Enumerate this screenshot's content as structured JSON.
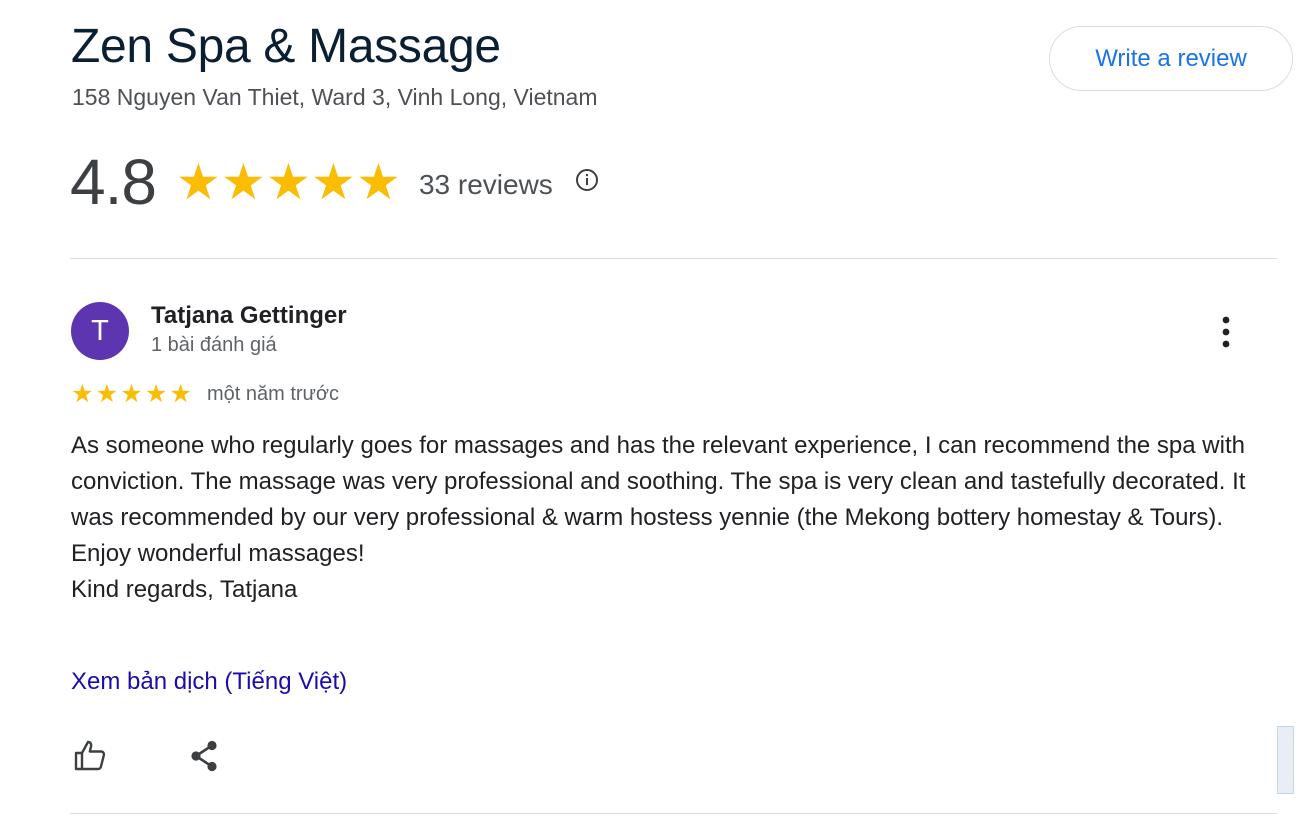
{
  "business": {
    "title": "Zen Spa & Massage",
    "address": "158 Nguyen Van Thiet, Ward 3, Vinh Long, Vietnam",
    "write_review_label": "Write a review"
  },
  "summary": {
    "rating": "4.8",
    "stars": 4.8,
    "review_count": "33 reviews",
    "info_icon": "info-icon"
  },
  "review": {
    "avatar_letter": "T",
    "avatar_color": "#5e35b1",
    "author": "Tatjana Gettinger",
    "author_meta": "1 bài đánh giá",
    "stars": 5,
    "date": "một năm trước",
    "paragraphs": [
      "As someone who regularly goes for massages and has the relevant experience, I can recommend the spa with conviction. The massage was very professional and soothing. The spa is very clean and tastefully decorated. It was recommended by our very professional & warm hostess yennie (the Mekong bottery homestay & Tours).",
      "Enjoy wonderful massages!",
      "Kind regards, Tatjana"
    ],
    "translate_label": "Xem bản dịch (Tiếng Việt)"
  },
  "colors": {
    "star": "#fbbc04",
    "link": "#1a0dab",
    "accent": "#1a73e8"
  }
}
